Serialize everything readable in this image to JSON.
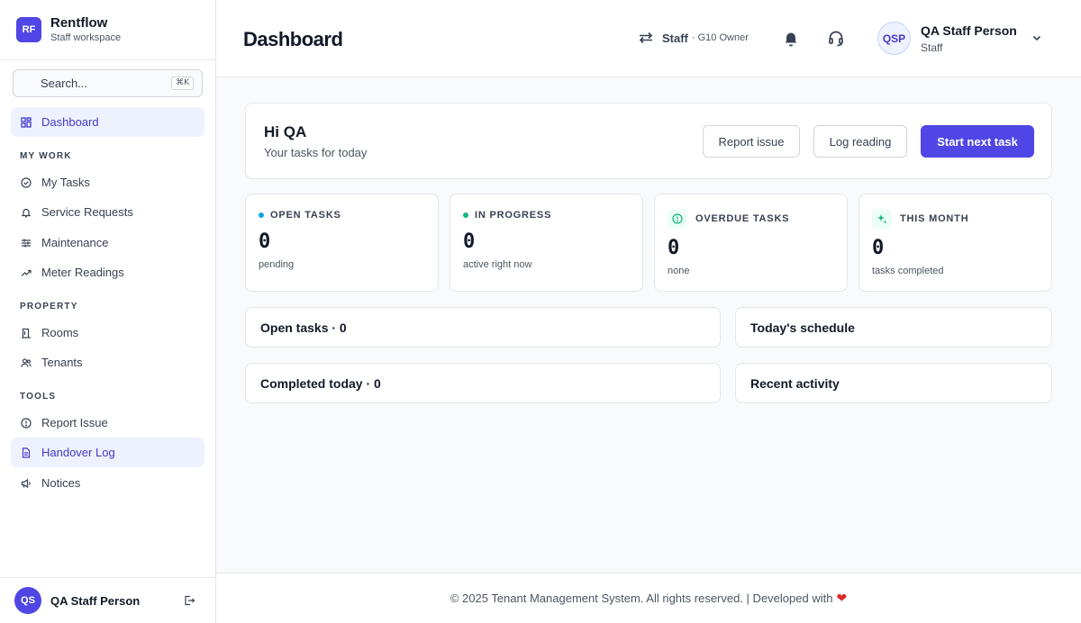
{
  "app": {
    "logo_initials": "RF",
    "name": "Rentflow",
    "subtitle": "Staff workspace"
  },
  "search": {
    "placeholder": "Search...",
    "shortcut": "⌘K"
  },
  "sidebar": {
    "top": {
      "label": "Dashboard",
      "icon": "grid-icon",
      "active": true
    },
    "sections": [
      {
        "title": "MY WORK",
        "items": [
          {
            "label": "My Tasks",
            "icon": "check-circle-icon"
          },
          {
            "label": "Service Requests",
            "icon": "bell-icon"
          },
          {
            "label": "Maintenance",
            "icon": "sliders-icon"
          },
          {
            "label": "Meter Readings",
            "icon": "trending-up-icon"
          }
        ]
      },
      {
        "title": "PROPERTY",
        "items": [
          {
            "label": "Rooms",
            "icon": "door-icon"
          },
          {
            "label": "Tenants",
            "icon": "users-icon"
          }
        ]
      },
      {
        "title": "TOOLS",
        "items": [
          {
            "label": "Report Issue",
            "icon": "alert-circle-icon"
          },
          {
            "label": "Handover Log",
            "icon": "document-icon",
            "active": true
          },
          {
            "label": "Notices",
            "icon": "megaphone-icon"
          }
        ]
      }
    ],
    "footer": {
      "initials": "QS",
      "name": "QA Staff Person"
    }
  },
  "header": {
    "title": "Dashboard",
    "role": {
      "name": "Staff",
      "detail": "· G10 Owner"
    },
    "user": {
      "initials": "QSP",
      "name": "QA Staff Person",
      "role": "Staff"
    }
  },
  "greeting": {
    "title": "Hi QA",
    "subtitle": "Your tasks for today",
    "buttons": {
      "report": "Report issue",
      "log": "Log reading",
      "start": "Start next task"
    }
  },
  "stats": [
    {
      "label": "OPEN TASKS",
      "value": "0",
      "sub": "pending",
      "accent": "#0ea5e9"
    },
    {
      "label": "IN PROGRESS",
      "value": "0",
      "sub": "active right now",
      "accent": "#10b981"
    },
    {
      "label": "OVERDUE TASKS",
      "value": "0",
      "sub": "none",
      "accent": "#10b981"
    },
    {
      "label": "THIS MONTH",
      "value": "0",
      "sub": "tasks completed",
      "accent": "#10b981"
    }
  ],
  "panels": {
    "open_tasks": "Open tasks · 0",
    "schedule": "Today's schedule",
    "completed": "Completed today · 0",
    "activity": "Recent activity"
  },
  "footer": {
    "text": "© 2025 Tenant Management System. All rights reserved. | Developed with",
    "heart": "❤"
  },
  "colors": {
    "accent": "#4f46e5",
    "active_bg": "#eef2ff"
  }
}
